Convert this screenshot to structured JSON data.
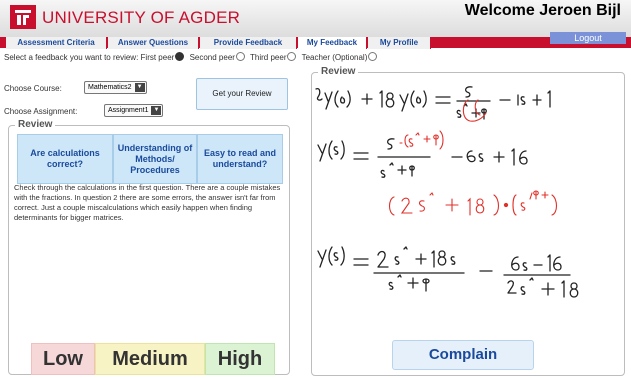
{
  "header": {
    "university_name": "UNIVERSITY OF AGDER",
    "welcome": "Welcome Jeroen Bijl",
    "logout": "Logout"
  },
  "tabs": [
    {
      "label": "Assessment Criteria"
    },
    {
      "label": "Answer Questions"
    },
    {
      "label": "Provide Feedback"
    },
    {
      "label": "My Feedback"
    },
    {
      "label": "My Profile"
    }
  ],
  "peer_select": {
    "prompt": "Select a feedback you want to review:",
    "options": [
      "First peer",
      "Second peer",
      "Third peer",
      "Teacher (Optional)"
    ],
    "selected": "First peer"
  },
  "course": {
    "label": "Choose Course:",
    "value": "Mathematics2"
  },
  "assignment": {
    "label": "Choose Assignment:",
    "value": "Assignment1"
  },
  "get_review": "Get your Review",
  "review_panel": {
    "title": "Review",
    "criteria": [
      "Are calculations correct?",
      "Understanding of Methods/ Procedures",
      "Easy to read and understand?"
    ],
    "feedback": "Check through the calculations in the first question. There are a couple mistakes with the fractions. In question 2 there are some errors, the answer isn't far from correct. Just a couple miscalculations which easily happen when finding determinants for bigger matrices.",
    "grades": {
      "low": "Low",
      "medium": "Medium",
      "high": "High"
    }
  },
  "answer_panel": {
    "title": "Review",
    "complain": "Complain"
  },
  "colors": {
    "brand_red": "#c8102e",
    "tab_text": "#1a4a9c",
    "low_bg": "#f7d8d8",
    "medium_bg": "#f8f3c4",
    "high_bg": "#dcf3d3",
    "correction_ink": "#e0302a"
  }
}
